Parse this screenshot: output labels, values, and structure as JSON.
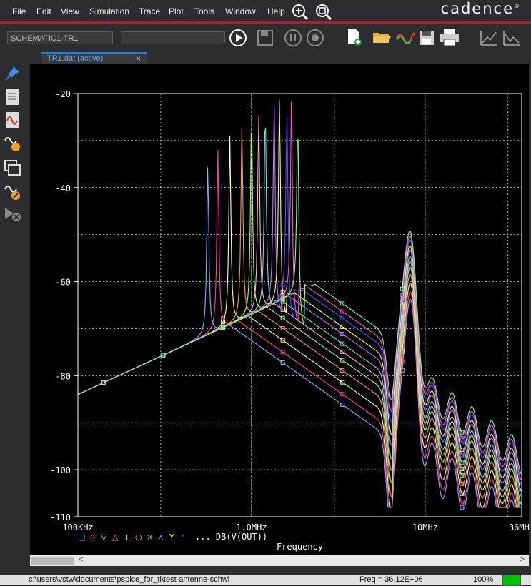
{
  "menu": {
    "items": [
      "File",
      "Edit",
      "View",
      "Simulation",
      "Trace",
      "Plot",
      "Tools",
      "Window",
      "Help"
    ]
  },
  "brand": {
    "logo": "cadence",
    "mark": "®"
  },
  "toolbar": {
    "profile_select": "SCHEMATIC1-TR1",
    "sim_select": "",
    "icons": [
      "run-icon",
      "save-disabled-icon",
      "pause-icon",
      "stop-icon",
      "new-file-icon",
      "open-folder-icon",
      "waveform-icon",
      "save-icon",
      "print-icon",
      "cursor-peak-icon",
      "cursor-trough-icon"
    ]
  },
  "tab": {
    "label": "TR1.dat (active)",
    "close": "×"
  },
  "sidebar": {
    "icons": [
      "pin-icon",
      "marker-list-icon",
      "probe-wave-icon",
      "probe-search-icon",
      "window-cascade-icon",
      "probe-edit-icon",
      "probe-delete-icon"
    ]
  },
  "colors": {
    "grid": "#ffffff",
    "tick": "#ffffff",
    "accent": "#0a84ff",
    "brand_red": "#c4122f",
    "status_ok": "#00c000"
  },
  "chart_data": {
    "type": "line",
    "xscale": "log",
    "xlim": [
      100000,
      36000000
    ],
    "ylim": [
      -110,
      -20
    ],
    "xlabel": "Frequency",
    "x_ticks": [
      "100KHz",
      "1.0MHz",
      "10MHz",
      "36MHz"
    ],
    "y_ticks": [
      "-20",
      "-40",
      "-60",
      "-80",
      "-100",
      "-110"
    ],
    "legend_symbols": [
      "□",
      "◇",
      "▽",
      "△",
      "+",
      "○",
      "×",
      "⋏",
      "Y",
      "*"
    ],
    "legend_label": "... DB(V(OUT))",
    "grid": true,
    "series": [
      {
        "color": "#7fb2ff",
        "peak_f": 560000,
        "peak_db": -35
      },
      {
        "color": "#ff3fa6",
        "peak_f": 640000,
        "peak_db": -32
      },
      {
        "color": "#ffffb0",
        "peak_f": 750000,
        "peak_db": -29
      },
      {
        "color": "#ff9a4a",
        "peak_f": 880000,
        "peak_db": -27
      },
      {
        "color": "#aaff6a",
        "peak_f": 1000000,
        "peak_db": -25
      },
      {
        "color": "#ffb0d0",
        "peak_f": 1100000,
        "peak_db": -24
      },
      {
        "color": "#6ae2e2",
        "peak_f": 1200000,
        "peak_db": -23
      },
      {
        "color": "#c070ff",
        "peak_f": 1350000,
        "peak_db": -21
      },
      {
        "color": "#ffff60",
        "peak_f": 1450000,
        "peak_db": -20
      },
      {
        "color": "#5050ff",
        "peak_f": 1600000,
        "peak_db": -20
      },
      {
        "color": "#ff4fd0",
        "peak_f": 1700000,
        "peak_db": -20
      },
      {
        "color": "#8aff8a",
        "peak_f": 1850000,
        "peak_db": -21
      }
    ]
  },
  "status": {
    "path": "c:\\users\\vstw\\documents\\pspice_for_ti\\test-antenne-schwi",
    "freq": "Freq =  36.12E+06",
    "zoom": "100%"
  }
}
